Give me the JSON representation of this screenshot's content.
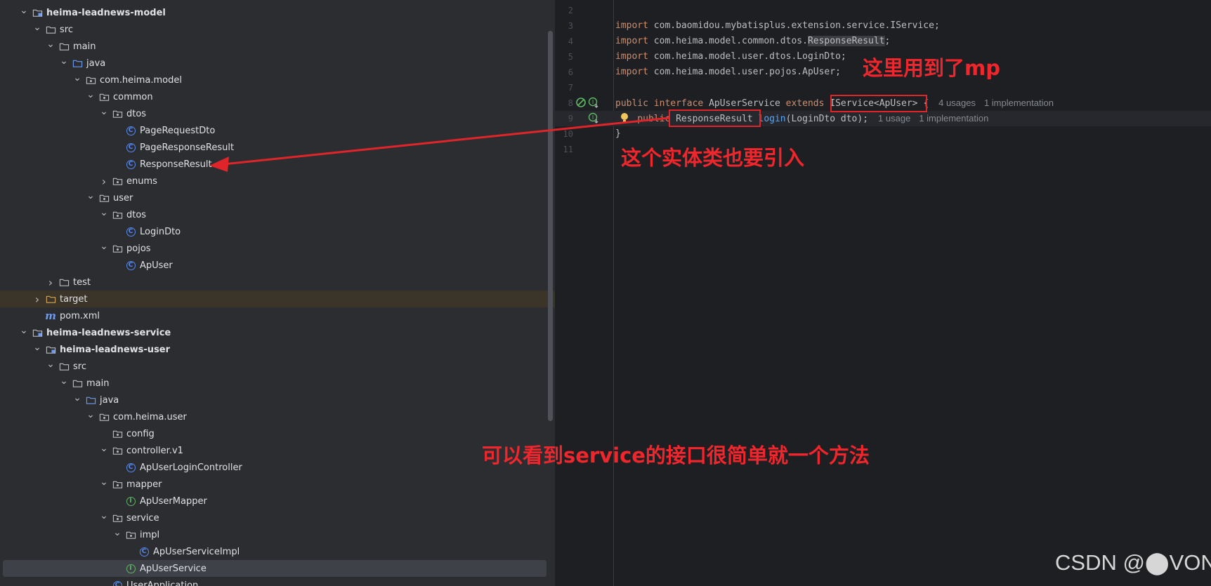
{
  "project_tree": [
    {
      "label": "heima-leadnews-model",
      "icon": "module-folder-icon",
      "depth": 1,
      "state": "expanded",
      "bold": true
    },
    {
      "label": "src",
      "icon": "folder-icon",
      "depth": 2,
      "state": "expanded"
    },
    {
      "label": "main",
      "icon": "folder-icon",
      "depth": 3,
      "state": "expanded"
    },
    {
      "label": "java",
      "icon": "source-folder-icon",
      "depth": 4,
      "state": "expanded"
    },
    {
      "label": "com.heima.model",
      "icon": "package-icon",
      "depth": 5,
      "state": "expanded"
    },
    {
      "label": "common",
      "icon": "package-icon",
      "depth": 6,
      "state": "expanded"
    },
    {
      "label": "dtos",
      "icon": "package-icon",
      "depth": 7,
      "state": "expanded"
    },
    {
      "label": "PageRequestDto",
      "icon": "class-icon",
      "depth": 8,
      "state": "leaf"
    },
    {
      "label": "PageResponseResult",
      "icon": "class-icon",
      "depth": 8,
      "state": "leaf"
    },
    {
      "label": "ResponseResult",
      "icon": "class-icon",
      "depth": 8,
      "state": "leaf"
    },
    {
      "label": "enums",
      "icon": "package-icon",
      "depth": 7,
      "state": "collapsed"
    },
    {
      "label": "user",
      "icon": "package-icon",
      "depth": 6,
      "state": "expanded"
    },
    {
      "label": "dtos",
      "icon": "package-icon",
      "depth": 7,
      "state": "expanded"
    },
    {
      "label": "LoginDto",
      "icon": "class-icon",
      "depth": 8,
      "state": "leaf"
    },
    {
      "label": "pojos",
      "icon": "package-icon",
      "depth": 7,
      "state": "expanded"
    },
    {
      "label": "ApUser",
      "icon": "class-icon",
      "depth": 8,
      "state": "leaf"
    },
    {
      "label": "test",
      "icon": "folder-icon",
      "depth": 3,
      "state": "collapsed"
    },
    {
      "label": "target",
      "icon": "excluded-folder-icon",
      "depth": 2,
      "state": "collapsed",
      "highlight": "target"
    },
    {
      "label": "pom.xml",
      "icon": "maven-icon",
      "depth": 2,
      "state": "leaf"
    },
    {
      "label": "heima-leadnews-service",
      "icon": "module-folder-icon",
      "depth": 1,
      "state": "expanded",
      "bold": true
    },
    {
      "label": "heima-leadnews-user",
      "icon": "module-folder-icon",
      "depth": 2,
      "state": "expanded",
      "bold": true
    },
    {
      "label": "src",
      "icon": "folder-icon",
      "depth": 3,
      "state": "expanded"
    },
    {
      "label": "main",
      "icon": "folder-icon",
      "depth": 4,
      "state": "expanded"
    },
    {
      "label": "java",
      "icon": "source-folder-icon",
      "depth": 5,
      "state": "expanded"
    },
    {
      "label": "com.heima.user",
      "icon": "package-icon",
      "depth": 6,
      "state": "expanded"
    },
    {
      "label": "config",
      "icon": "package-icon",
      "depth": 7,
      "state": "leaf"
    },
    {
      "label": "controller.v1",
      "icon": "package-icon",
      "depth": 7,
      "state": "expanded"
    },
    {
      "label": "ApUserLoginController",
      "icon": "class-icon",
      "depth": 8,
      "state": "leaf"
    },
    {
      "label": "mapper",
      "icon": "package-icon",
      "depth": 7,
      "state": "expanded"
    },
    {
      "label": "ApUserMapper",
      "icon": "interface-icon",
      "depth": 8,
      "state": "leaf"
    },
    {
      "label": "service",
      "icon": "package-icon",
      "depth": 7,
      "state": "expanded"
    },
    {
      "label": "impl",
      "icon": "package-icon",
      "depth": 8,
      "state": "expanded"
    },
    {
      "label": "ApUserServiceImpl",
      "icon": "class-icon",
      "depth": 9,
      "state": "leaf"
    },
    {
      "label": "ApUserService",
      "icon": "interface-icon",
      "depth": 8,
      "state": "leaf",
      "highlight": "selected"
    },
    {
      "label": "UserApplication",
      "icon": "class-icon",
      "depth": 7,
      "state": "leaf"
    }
  ],
  "editor": {
    "lines": [
      {
        "num": "2",
        "code": []
      },
      {
        "num": "3",
        "code": [
          {
            "t": "import ",
            "c": "kw"
          },
          {
            "t": "com.baomidou.mybatisplus.extension.service.IService;"
          }
        ]
      },
      {
        "num": "4",
        "code": [
          {
            "t": "import ",
            "c": "kw"
          },
          {
            "t": "com.heima.model.common.dtos."
          },
          {
            "t": "ResponseResult",
            "c": "hl"
          },
          {
            "t": ";"
          }
        ]
      },
      {
        "num": "5",
        "code": [
          {
            "t": "import ",
            "c": "kw"
          },
          {
            "t": "com.heima.model.user.dtos.LoginDto;"
          }
        ]
      },
      {
        "num": "6",
        "code": [
          {
            "t": "import ",
            "c": "kw"
          },
          {
            "t": "com.heima.model.user.pojos.ApUser;"
          }
        ]
      },
      {
        "num": "7",
        "code": []
      },
      {
        "num": "8",
        "code": [
          {
            "t": "public ",
            "c": "kw"
          },
          {
            "t": "interface ",
            "c": "kw"
          },
          {
            "t": "ApUserService "
          },
          {
            "t": "extends ",
            "c": "kw"
          },
          {
            "t": "IService<ApUser>"
          },
          {
            "t": " {"
          }
        ],
        "hints": [
          "4 usages",
          "1 implementation"
        ]
      },
      {
        "num": "9",
        "code": [
          {
            "t": "    public ",
            "c": "kw"
          },
          {
            "t": "ResponseResult "
          },
          {
            "t": "login",
            "c": "fn"
          },
          {
            "t": "(LoginDto dto);"
          }
        ],
        "hints": [
          "1 usage",
          "1 implementation"
        ],
        "current": true
      },
      {
        "num": "10",
        "code": [
          {
            "t": "}"
          }
        ]
      },
      {
        "num": "11",
        "code": []
      }
    ]
  },
  "annotations": {
    "mp_note": "这里用到了mp",
    "entity_note": "这个实体类也要引入",
    "summary_note": "可以看到service的接口很简单就一个方法",
    "color": "#f0262c"
  },
  "watermark": "CSDN @⬤VON"
}
